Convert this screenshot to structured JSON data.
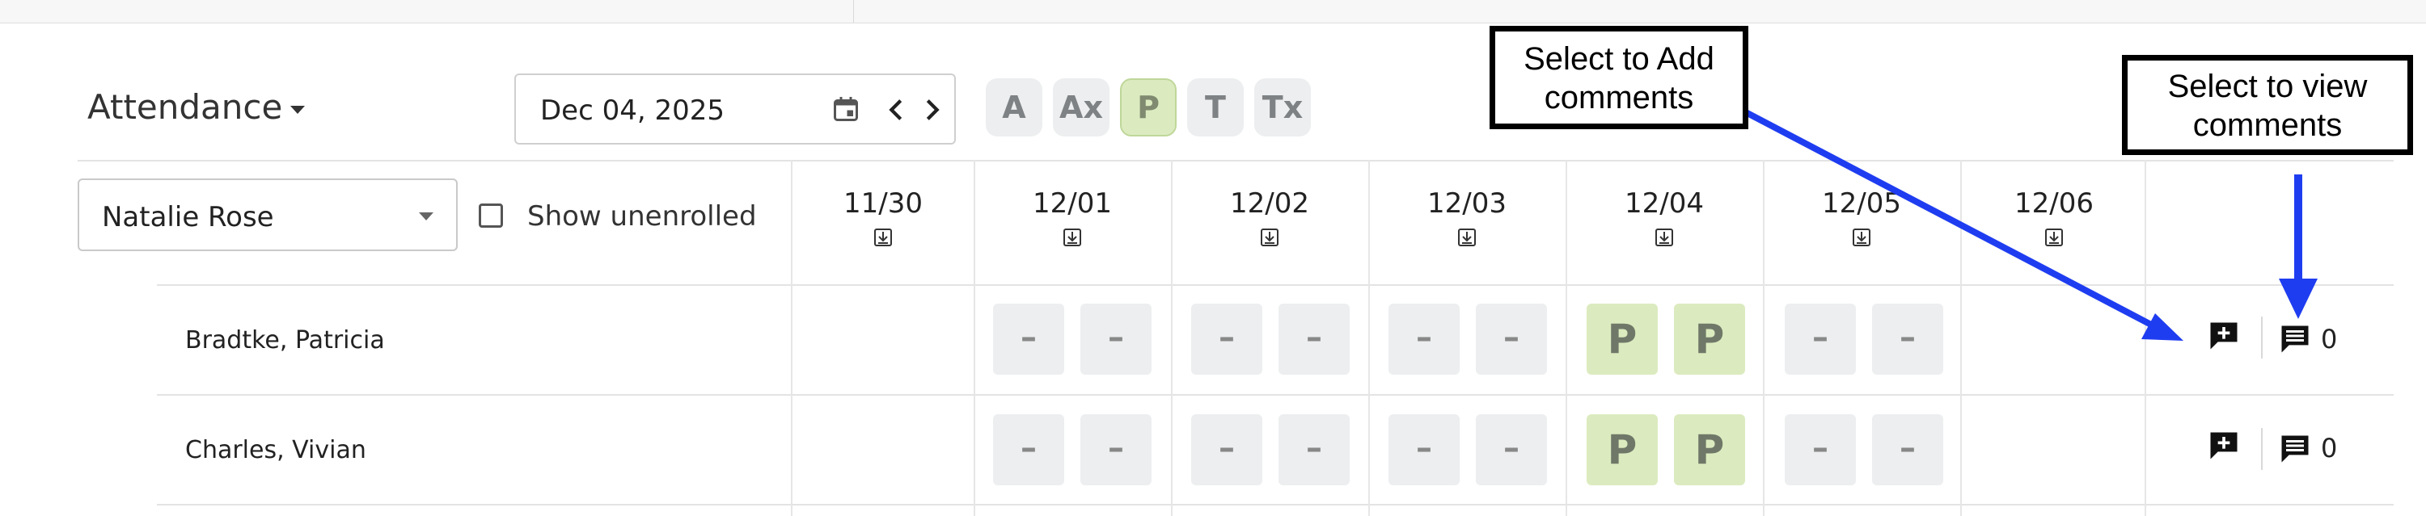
{
  "attendance": {
    "title": "Attendance"
  },
  "date_picker": {
    "value": "Dec 04, 2025"
  },
  "codes": [
    "A",
    "Ax",
    "P",
    "T",
    "Tx"
  ],
  "selected_code": "P",
  "student_filter": {
    "value": "Natalie Rose"
  },
  "show_unenrolled": {
    "label": "Show unenrolled",
    "checked": false
  },
  "days": [
    "11/30",
    "12/01",
    "12/02",
    "12/03",
    "12/04",
    "12/05",
    "12/06"
  ],
  "rows": [
    {
      "name": "Bradtke, Patricia",
      "cells": [
        "",
        "- -",
        "- -",
        "- -",
        "P P",
        "- -",
        ""
      ],
      "comment_count": "0"
    },
    {
      "name": "Charles, Vivian",
      "cells": [
        "",
        "- -",
        "- -",
        "- -",
        "P P",
        "- -",
        ""
      ],
      "comment_count": "0"
    }
  ],
  "callouts": {
    "add": "Select to Add comments",
    "view": "Select to view comments"
  },
  "colors": {
    "present": "#dcebbf",
    "empty_cell": "#eceeef",
    "arrow": "#1f3df0"
  },
  "icons": [
    "calendar-icon",
    "chevron-left-icon",
    "chevron-right-icon",
    "download-icon",
    "add-comment-icon",
    "comment-icon"
  ]
}
